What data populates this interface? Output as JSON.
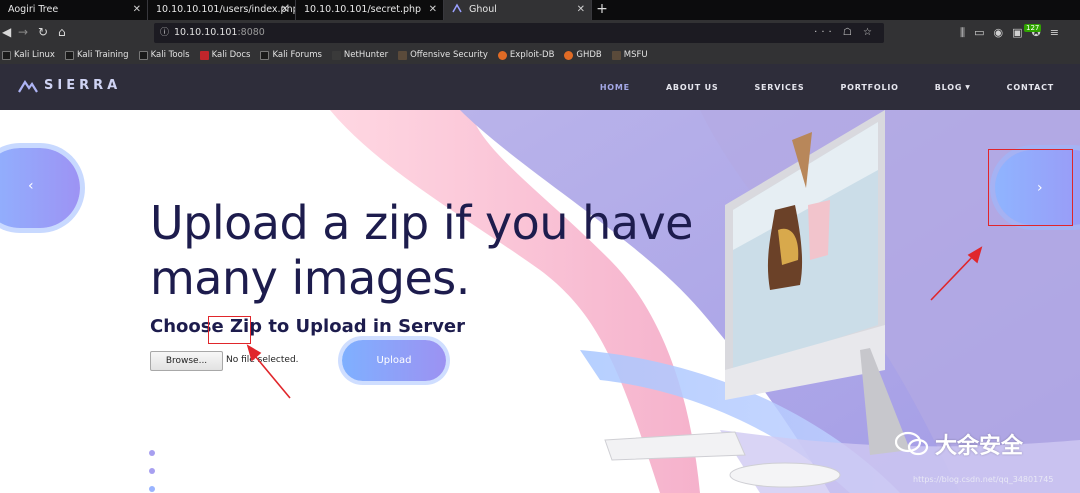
{
  "browser": {
    "tabs": [
      {
        "label": "Aogiri Tree",
        "active": false
      },
      {
        "label": "10.10.10.101/users/index.php",
        "active": false
      },
      {
        "label": "10.10.10.101/secret.php",
        "active": false
      },
      {
        "label": "Ghoul",
        "active": true
      }
    ],
    "new_tab": "+",
    "url_host": "10.10.10.101",
    "url_port": ":8080",
    "url_actions": "··· ☖ ☆",
    "extension_badge": "127",
    "bookmarks": [
      "Kali Linux",
      "Kali Training",
      "Kali Tools",
      "Kali Docs",
      "Kali Forums",
      "NetHunter",
      "Offensive Security",
      "Exploit-DB",
      "GHDB",
      "MSFU"
    ]
  },
  "site": {
    "logo": "SIERRA",
    "menu": [
      {
        "label": "HOME",
        "active": true
      },
      {
        "label": "ABOUT US",
        "active": false
      },
      {
        "label": "SERVICES",
        "active": false
      },
      {
        "label": "PORTFOLIO",
        "active": false
      },
      {
        "label": "BLOG",
        "active": false,
        "dropdown": true
      },
      {
        "label": "CONTACT",
        "active": false
      }
    ]
  },
  "hero": {
    "title": "Upload a zip if you have many images.",
    "subtitle": "Choose Zip to Upload in Server",
    "browse_label": "Browse...",
    "file_status": "No file selected.",
    "upload_label": "Upload",
    "prev_arrow": "‹",
    "next_arrow": "›"
  },
  "watermark": {
    "text": "大余安全",
    "url": "https://blog.csdn.net/qq_34801745"
  },
  "colors": {
    "header_bg": "#2e2d3a",
    "title": "#1d1c4d",
    "accent_purple": "#9c92f2",
    "accent_blue": "#7fb0ff",
    "annotation_red": "#e0262b"
  }
}
